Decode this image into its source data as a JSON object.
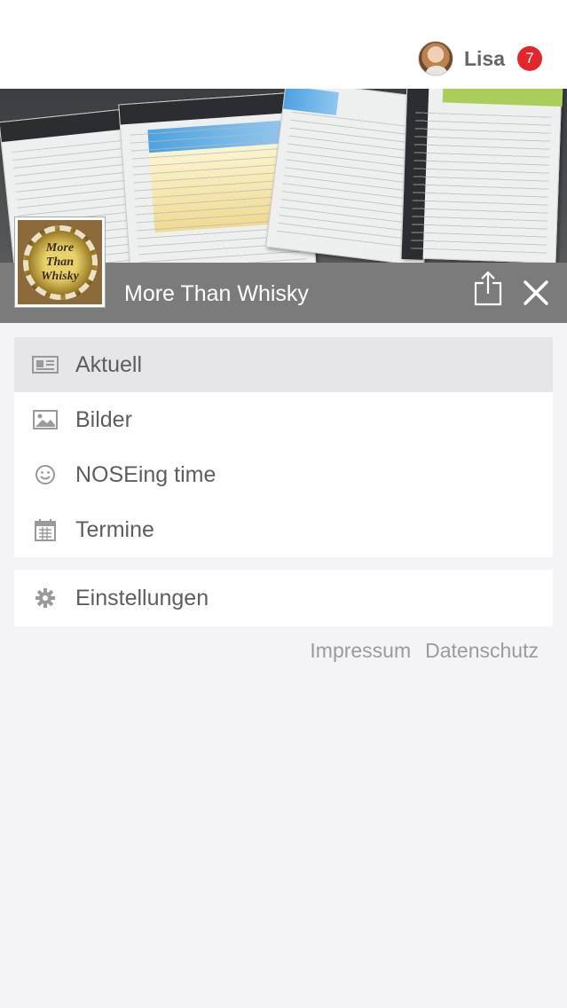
{
  "user": {
    "name": "Lisa",
    "notification_count": "7"
  },
  "header": {
    "title": "More Than Whisky",
    "logo_text": "More Than Whisky"
  },
  "menu": {
    "items": [
      {
        "label": "Aktuell",
        "icon": "newspaper-icon",
        "active": true
      },
      {
        "label": "Bilder",
        "icon": "image-icon",
        "active": false
      },
      {
        "label": "NOSEing time",
        "icon": "smiley-icon",
        "active": false
      },
      {
        "label": "Termine",
        "icon": "calendar-icon",
        "active": false
      }
    ],
    "settings_label": "Einstellungen"
  },
  "footer": {
    "impressum": "Impressum",
    "datenschutz": "Datenschutz"
  },
  "colors": {
    "badge": "#e3262b",
    "title_bar": "#7b7b7b",
    "active_row": "#e6e6e8",
    "background": "#f4f4f6"
  }
}
